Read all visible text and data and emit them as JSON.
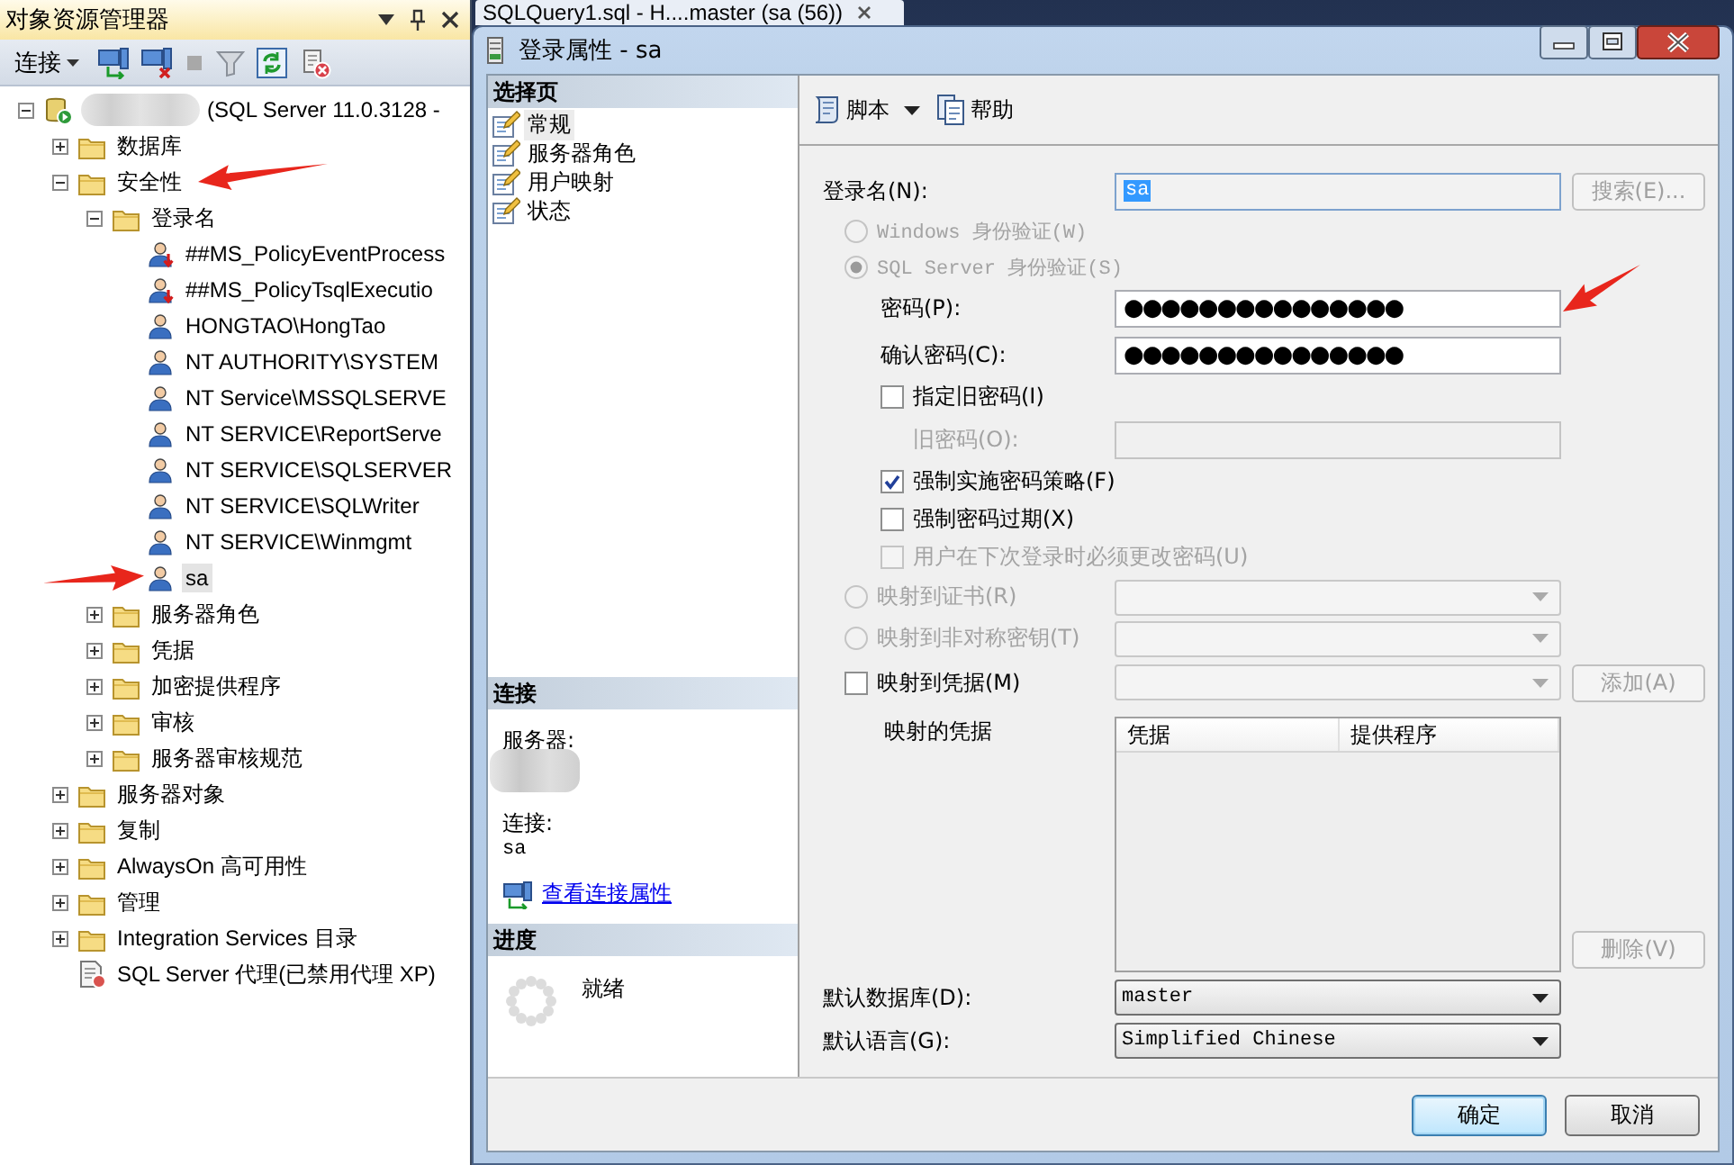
{
  "explorer": {
    "title": "对象资源管理器",
    "connect": "连接",
    "tree": [
      {
        "kind": "server",
        "label": "(SQL Server 11.0.3128 -",
        "expanded": true,
        "selected": false,
        "children": [
          {
            "kind": "folder",
            "label": "数据库",
            "expanded": false,
            "selected": false
          },
          {
            "kind": "folder",
            "label": "安全性",
            "expanded": true,
            "selected": false,
            "children": [
              {
                "kind": "folder",
                "label": "登录名",
                "expanded": true,
                "selected": false,
                "children": [
                  {
                    "kind": "login",
                    "label": "##MS_PolicyEventProcess",
                    "disabled": true,
                    "selected": false
                  },
                  {
                    "kind": "login",
                    "label": "##MS_PolicyTsqlExecutio",
                    "disabled": true,
                    "selected": false
                  },
                  {
                    "kind": "login",
                    "label": "HONGTAO\\HongTao",
                    "disabled": false,
                    "selected": false
                  },
                  {
                    "kind": "login",
                    "label": "NT AUTHORITY\\SYSTEM",
                    "disabled": false,
                    "selected": false
                  },
                  {
                    "kind": "login",
                    "label": "NT Service\\MSSQLSERVE",
                    "disabled": false,
                    "selected": false
                  },
                  {
                    "kind": "login",
                    "label": "NT SERVICE\\ReportServe",
                    "disabled": false,
                    "selected": false
                  },
                  {
                    "kind": "login",
                    "label": "NT SERVICE\\SQLSERVER",
                    "disabled": false,
                    "selected": false
                  },
                  {
                    "kind": "login",
                    "label": "NT SERVICE\\SQLWriter",
                    "disabled": false,
                    "selected": false
                  },
                  {
                    "kind": "login",
                    "label": "NT SERVICE\\Winmgmt",
                    "disabled": false,
                    "selected": false
                  },
                  {
                    "kind": "login",
                    "label": "sa",
                    "disabled": false,
                    "selected": true
                  }
                ]
              },
              {
                "kind": "folder",
                "label": "服务器角色",
                "expanded": false,
                "selected": false
              },
              {
                "kind": "folder",
                "label": "凭据",
                "expanded": false,
                "selected": false
              },
              {
                "kind": "folder",
                "label": "加密提供程序",
                "expanded": false,
                "selected": false
              },
              {
                "kind": "folder",
                "label": "审核",
                "expanded": false,
                "selected": false
              },
              {
                "kind": "folder",
                "label": "服务器审核规范",
                "expanded": false,
                "selected": false
              }
            ]
          },
          {
            "kind": "folder",
            "label": "服务器对象",
            "expanded": false,
            "selected": false
          },
          {
            "kind": "folder",
            "label": "复制",
            "expanded": false,
            "selected": false
          },
          {
            "kind": "folder",
            "label": "AlwaysOn 高可用性",
            "expanded": false,
            "selected": false
          },
          {
            "kind": "folder",
            "label": "管理",
            "expanded": false,
            "selected": false
          },
          {
            "kind": "folder",
            "label": "Integration Services 目录",
            "expanded": false,
            "selected": false
          },
          {
            "kind": "agent",
            "label": "SQL Server 代理(已禁用代理 XP)",
            "selected": false
          }
        ]
      }
    ]
  },
  "query_tab": {
    "title": "SQLQuery1.sql - H....master (sa (56))"
  },
  "dialog": {
    "title": "登录属性 - sa",
    "pages_header": "选择页",
    "pages": [
      {
        "label": "常规",
        "selected": true
      },
      {
        "label": "服务器角色",
        "selected": false
      },
      {
        "label": "用户映射",
        "selected": false
      },
      {
        "label": "状态",
        "selected": false
      }
    ],
    "connection": {
      "header": "连接",
      "server_label": "服务器:",
      "connection_label": "连接:",
      "connection_value": "sa",
      "link": "查看连接属性"
    },
    "progress": {
      "header": "进度",
      "status": "就绪"
    },
    "toolbar": {
      "script": "脚本",
      "help": "帮助"
    },
    "form": {
      "rows": [
        {
          "kind": "text",
          "label": "登录名(N):",
          "value": "sa",
          "button": {
            "label": "搜索(E)...",
            "disabled": true
          }
        },
        {
          "kind": "radio",
          "label": "Windows 身份验证(W)",
          "selected": false,
          "disabled": true
        },
        {
          "kind": "radio",
          "label": "SQL Server 身份验证(S)",
          "selected": true,
          "disabled": true,
          "children": [
            {
              "kind": "password",
              "label": "密码(P):",
              "value": "●●●●●●●●●●●●●●●",
              "disabled": false
            },
            {
              "kind": "password",
              "label": "确认密码(C):",
              "value": "●●●●●●●●●●●●●●●",
              "disabled": false
            },
            {
              "kind": "checkbox",
              "label": "指定旧密码(I)",
              "checked": false,
              "disabled": false,
              "children": [
                {
                  "kind": "password",
                  "label": "旧密码(O):",
                  "disabled": true
                }
              ]
            },
            {
              "kind": "checkbox",
              "label": "强制实施密码策略(F)",
              "checked": true,
              "disabled": false
            },
            {
              "kind": "checkbox",
              "label": "强制密码过期(X)",
              "checked": false,
              "disabled": false
            },
            {
              "kind": "checkbox",
              "label": "用户在下次登录时必须更改密码(U)",
              "checked": false,
              "disabled": true
            }
          ]
        },
        {
          "kind": "radio-combo",
          "label": "映射到证书(R)",
          "selected": false,
          "disabled": true
        },
        {
          "kind": "radio-combo",
          "label": "映射到非对称密钥(T)",
          "selected": false,
          "disabled": true
        },
        {
          "kind": "checkbox-combo",
          "label": "映射到凭据(M)",
          "checked": false,
          "disabled": false,
          "button": {
            "label": "添加(A)",
            "disabled": true
          }
        },
        {
          "kind": "table",
          "label": "映射的凭据",
          "columns": [
            "凭据",
            "提供程序"
          ],
          "button": {
            "label": "删除(V)",
            "disabled": true
          }
        },
        {
          "kind": "select",
          "label": "默认数据库(D):",
          "value": "master"
        },
        {
          "kind": "select",
          "label": "默认语言(G):",
          "value": "Simplified Chinese"
        }
      ]
    },
    "buttons": [
      {
        "label": "确定",
        "default": true
      },
      {
        "label": "取消",
        "default": false
      }
    ]
  }
}
